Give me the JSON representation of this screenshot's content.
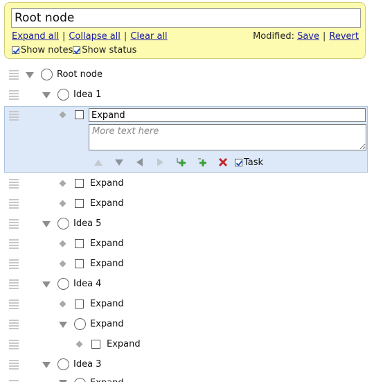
{
  "header": {
    "title_value": "Root node",
    "expand_all": "Expand all",
    "collapse_all": "Collapse all",
    "clear_all": "Clear all",
    "modified_label": "Modified:",
    "save": "Save",
    "revert": "Revert",
    "show_notes": "Show notes",
    "show_status": "Show status",
    "show_notes_checked": true,
    "show_status_checked": true
  },
  "tree": {
    "root": "Root node",
    "idea1": "Idea 1",
    "idea5": "Idea 5",
    "idea4": "Idea 4",
    "idea3": "Idea 3",
    "expand": "Expand"
  },
  "editor": {
    "value": "Expand",
    "notes_placeholder": "More text here",
    "task_label": "Task",
    "task_checked": true
  },
  "icons": {
    "drag": "drag-handle-icon",
    "collapse": "triangle-down-icon",
    "leaf": "diamond-icon",
    "status_circle": "circle-status-icon",
    "status_check": "checkbox-status-icon",
    "move_up": "arrow-up-icon",
    "move_down": "arrow-down-icon",
    "outdent": "arrow-left-icon",
    "indent": "arrow-right-icon",
    "add_child": "add-child-icon",
    "add_sibling": "add-sibling-icon",
    "delete": "delete-icon"
  },
  "colors": {
    "header_bg": "#fdfbb0",
    "selection_bg": "#dde9f8",
    "link": "#1a1aa6",
    "add": "#3aa03a",
    "delete": "#c0262c"
  }
}
